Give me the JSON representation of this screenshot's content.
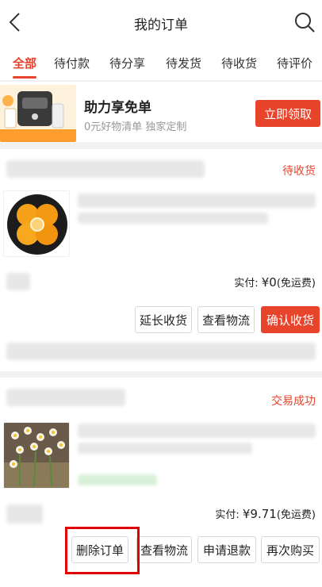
{
  "header": {
    "title": "我的订单"
  },
  "tabs": [
    "全部",
    "待付款",
    "待分享",
    "待发货",
    "待收货",
    "待评价"
  ],
  "promo": {
    "title": "助力享免单",
    "subtitle": "0元好物清单  独家定制",
    "button": "立即领取"
  },
  "orders": [
    {
      "status": "待收货",
      "paid_label": "实付:",
      "paid_amount": "¥0",
      "paid_note": "(免运费)",
      "buttons": [
        "延长收货",
        "查看物流",
        "确认收货"
      ]
    },
    {
      "status": "交易成功",
      "paid_label": "实付:",
      "paid_amount": "¥9.71",
      "paid_note": "(免运费)",
      "buttons": [
        "删除订单",
        "查看物流",
        "申请退款",
        "再次购买"
      ]
    }
  ],
  "colors": {
    "accent": "#e8442c",
    "highlight": "#e00000"
  }
}
